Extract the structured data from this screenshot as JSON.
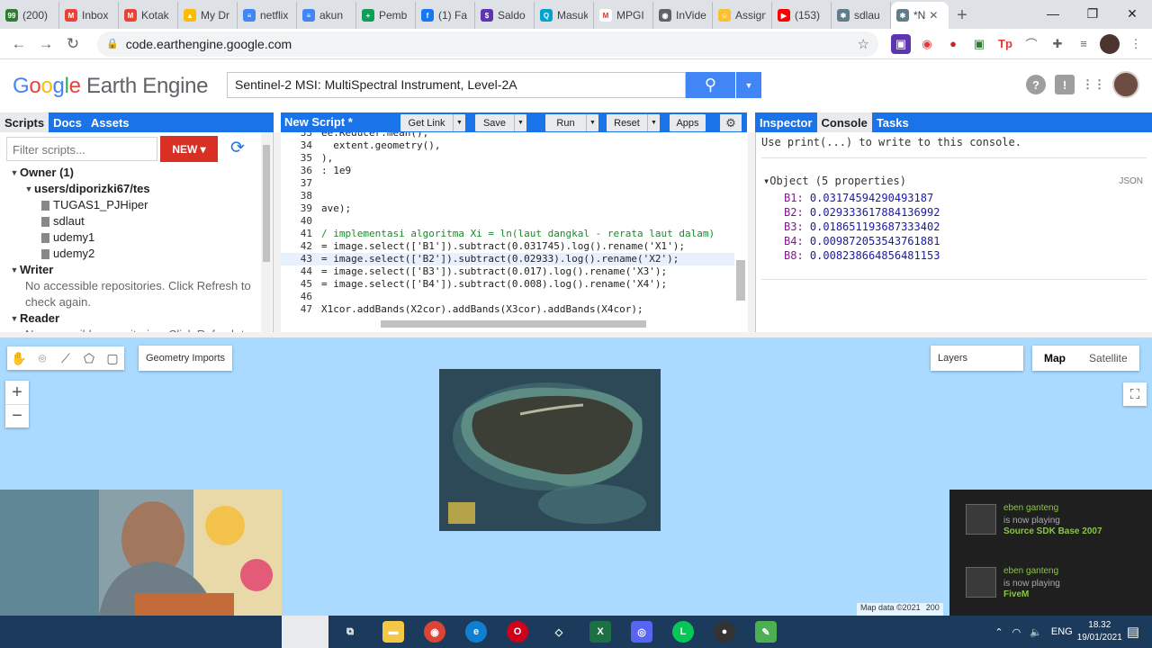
{
  "browser": {
    "tabs": [
      {
        "label": "(200)",
        "color": "#2e7d32",
        "glyph": "99"
      },
      {
        "label": "Inbox",
        "color": "#ea4335",
        "glyph": "M"
      },
      {
        "label": "Kotak",
        "color": "#ea4335",
        "glyph": "M"
      },
      {
        "label": "My Dr",
        "color": "#fbbc05",
        "glyph": "▲"
      },
      {
        "label": "netflix",
        "color": "#4285f4",
        "glyph": "≡"
      },
      {
        "label": "akun",
        "color": "#4285f4",
        "glyph": "≡"
      },
      {
        "label": "Pemb",
        "color": "#0f9d58",
        "glyph": "+"
      },
      {
        "label": "(1) Fa",
        "color": "#1877f2",
        "glyph": "f"
      },
      {
        "label": "Saldo",
        "color": "#5e35b1",
        "glyph": "$"
      },
      {
        "label": "Masuk",
        "color": "#00a5ce",
        "glyph": "Q"
      },
      {
        "label": "MPGI",
        "color": "#ffffff",
        "glyph": "M"
      },
      {
        "label": "InVide",
        "color": "#5f6368",
        "glyph": "◉"
      },
      {
        "label": "Assign",
        "color": "#fbc02d",
        "glyph": "☺"
      },
      {
        "label": "(153)",
        "color": "#ff0000",
        "glyph": "▶"
      },
      {
        "label": "sdlau",
        "color": "#607d8b",
        "glyph": "✱"
      }
    ],
    "active_tab": {
      "label": "*N",
      "glyph": "✱"
    },
    "url": "code.earthengine.google.com",
    "window_controls": {
      "min": "—",
      "max": "❐",
      "close": "✕"
    }
  },
  "gee": {
    "logo": {
      "g": "G",
      "o1": "o",
      "o2": "o",
      "g2": "g",
      "l": "l",
      "e": "e",
      "rest": " Earth Engine"
    },
    "search_value": "Sentinel-2 MSI: MultiSpectral Instrument, Level-2A",
    "left_tabs": [
      "Scripts",
      "Docs",
      "Assets"
    ],
    "filter_placeholder": "Filter scripts...",
    "new_label": "NEW ▾",
    "tree": {
      "owner": "Owner  (1)",
      "repo": "users/diporizki67/tes",
      "files": [
        "TUGAS1_PJHiper",
        "sdlaut",
        "udemy1",
        "udemy2"
      ],
      "writer": "Writer",
      "writer_note": "No accessible repositories. Click Refresh to check again.",
      "reader": "Reader",
      "reader_note": "No accessible repositories. Click Refresh to"
    },
    "editor": {
      "title": "New Script *",
      "buttons": {
        "get_link": "Get Link",
        "save": "Save",
        "run": "Run",
        "reset": "Reset",
        "apps": "Apps"
      },
      "lines": [
        {
          "n": "33",
          "text": "ee.Reducer.mean(),"
        },
        {
          "n": "34",
          "text": "  extent.geometry(),"
        },
        {
          "n": "35",
          "text": "),"
        },
        {
          "n": "36",
          "text": ": 1e9"
        },
        {
          "n": "37",
          "text": ""
        },
        {
          "n": "38",
          "text": ""
        },
        {
          "n": "39",
          "text": "ave);"
        },
        {
          "n": "40",
          "text": ""
        },
        {
          "n": "41",
          "text": "/ implementasi algoritma Xi = ln(laut dangkal - rerata laut dalam)"
        },
        {
          "n": "42",
          "text": "= image.select(['B1']).subtract(0.031745).log().rename('X1');"
        },
        {
          "n": "43",
          "text": "= image.select(['B2']).subtract(0.02933).log().rename('X2');"
        },
        {
          "n": "44",
          "text": "= image.select(['B3']).subtract(0.017).log().rename('X3');"
        },
        {
          "n": "45",
          "text": "= image.select(['B4']).subtract(0.008).log().rename('X4');"
        },
        {
          "n": "46",
          "text": ""
        },
        {
          "n": "47",
          "text": "X1cor.addBands(X2cor).addBands(X3cor).addBands(X4cor);"
        }
      ]
    },
    "right_tabs": [
      "Inspector",
      "Console",
      "Tasks"
    ],
    "console": {
      "hint": "Use print(...) to write to this console.",
      "object_label": "▾Object (5 properties)",
      "json_label": "JSON",
      "props": [
        {
          "k": "B1:",
          "v": "0.03174594290493187"
        },
        {
          "k": "B2:",
          "v": "0.029333617884136992"
        },
        {
          "k": "B3:",
          "v": "0.018651193687333402"
        },
        {
          "k": "B4:",
          "v": "0.009872053543761881"
        },
        {
          "k": "B8:",
          "v": "0.008238664856481153"
        }
      ]
    },
    "map": {
      "geometry_imports": "Geometry Imports",
      "layers": "Layers",
      "map_btn": "Map",
      "satellite_btn": "Satellite",
      "zoom_in": "+",
      "zoom_out": "−",
      "attribution": "Map data ©2021",
      "scale": "200"
    }
  },
  "notifications": [
    {
      "name": "eben ganteng",
      "status": "is now playing",
      "game": "Source SDK Base 2007"
    },
    {
      "name": "eben ganteng",
      "status": "is now playing",
      "game": "FiveM"
    }
  ],
  "taskbar": {
    "lang": "ENG",
    "time": "18.32",
    "date": "19/01/2021"
  }
}
